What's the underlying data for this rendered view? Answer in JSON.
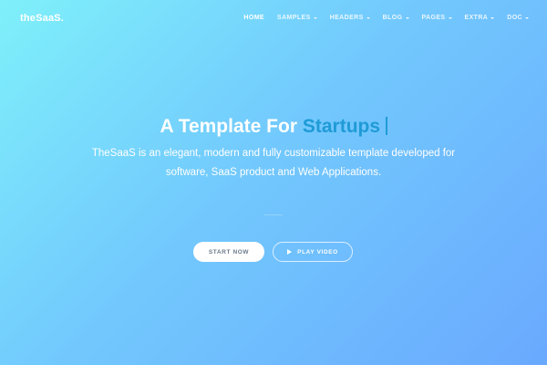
{
  "brand": {
    "logo_text": "theSaaS."
  },
  "nav": {
    "items": [
      {
        "label": "HOME",
        "icon": "",
        "active": true
      },
      {
        "label": "SAMPLES",
        "icon": "caret-down-icon",
        "active": false
      },
      {
        "label": "HEADERS",
        "icon": "caret-down-icon",
        "active": false
      },
      {
        "label": "BLOG",
        "icon": "caret-down-icon",
        "active": false
      },
      {
        "label": "PAGES",
        "icon": "caret-down-icon",
        "active": false
      },
      {
        "label": "EXTRA",
        "icon": "caret-down-icon",
        "active": false
      },
      {
        "label": "DOC",
        "icon": "caret-down-icon",
        "active": false
      }
    ]
  },
  "hero": {
    "headline_prefix": "A Template For",
    "headline_accent": "Startups",
    "lead_line1": "TheSaaS is an elegant, modern and fully customizable template developed for",
    "lead_line2": "software, SaaS product and Web Applications.",
    "start_button_label": "START NOW",
    "play_button_label": "PLAY VIDEO",
    "play_button_icon": "play-icon"
  },
  "colors": {
    "gradient_start": "#7ff0fa",
    "gradient_end": "#6aa9fe",
    "accent": "#1f9bd6",
    "button_text": "#6b7a8a"
  }
}
